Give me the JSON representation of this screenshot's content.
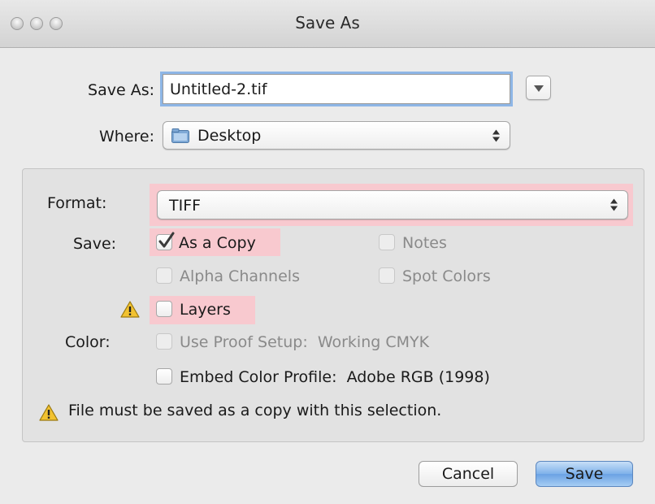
{
  "window": {
    "title": "Save As"
  },
  "save_as": {
    "label": "Save As:",
    "value": "Untitled-2.tif"
  },
  "where": {
    "label": "Where:",
    "value": "Desktop",
    "icon": "folder-icon"
  },
  "options": {
    "format": {
      "label": "Format:",
      "value": "TIFF"
    },
    "save_label": "Save:",
    "as_a_copy": {
      "label": "As a Copy",
      "checked": true,
      "enabled": true
    },
    "notes": {
      "label": "Notes",
      "checked": false,
      "enabled": false
    },
    "alpha_channels": {
      "label": "Alpha Channels",
      "checked": false,
      "enabled": false
    },
    "spot_colors": {
      "label": "Spot Colors",
      "checked": false,
      "enabled": false
    },
    "layers": {
      "label": "Layers",
      "checked": false,
      "enabled": true,
      "warning": true
    },
    "color_label": "Color:",
    "use_proof_setup": {
      "label": "Use Proof Setup:  Working CMYK",
      "checked": false,
      "enabled": false
    },
    "embed_color_profile": {
      "label": "Embed Color Profile:  Adobe RGB (1998)",
      "checked": false,
      "enabled": true
    },
    "warning_message": "File must be saved as a copy with this selection."
  },
  "buttons": {
    "cancel": "Cancel",
    "save": "Save"
  },
  "colors": {
    "highlight": "#f8c9cf",
    "focus_ring": "#8eb6e6",
    "default_button": "#6aa2e4",
    "warning": "#f2c230"
  }
}
